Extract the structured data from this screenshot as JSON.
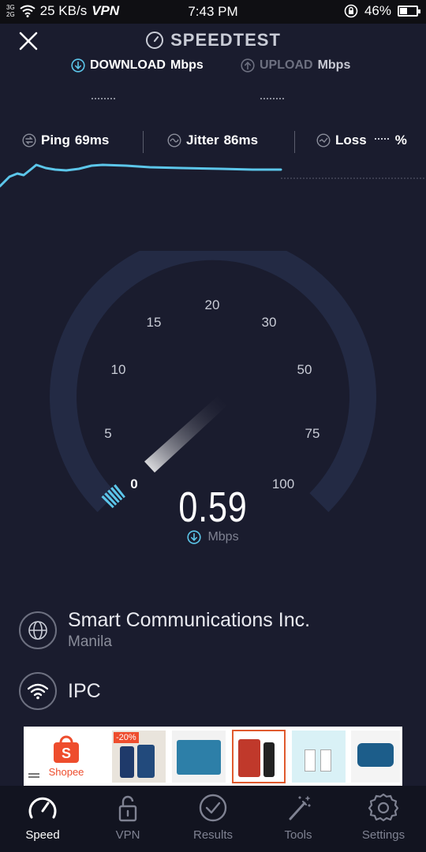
{
  "status_bar": {
    "net_top": "3G",
    "net_bottom": "2G",
    "speed": "25 KB/s",
    "vpn": "VPN",
    "time": "7:43 PM",
    "battery": "46%",
    "battery_level": 0.46
  },
  "header": {
    "title": "SPEEDTEST",
    "download_label": "DOWNLOAD",
    "upload_label": "UPLOAD",
    "unit": "Mbps"
  },
  "stats": {
    "ping_label": "Ping",
    "ping_value": "69ms",
    "jitter_label": "Jitter",
    "jitter_value": "86ms",
    "loss_label": "Loss",
    "loss_unit": "%"
  },
  "gauge": {
    "scale_labels": [
      "0",
      "5",
      "10",
      "15",
      "20",
      "30",
      "50",
      "75",
      "100"
    ],
    "value": "0.59",
    "unit": "Mbps"
  },
  "provider": {
    "name": "Smart Communications Inc.",
    "location": "Manila"
  },
  "network": {
    "name": "IPC"
  },
  "ad": {
    "brand": "Shopee",
    "discount": "-20%"
  },
  "tabs": [
    {
      "label": "Speed",
      "icon": "speedometer-icon",
      "active": true
    },
    {
      "label": "VPN",
      "icon": "lock-icon",
      "active": false
    },
    {
      "label": "Results",
      "icon": "check-circle-icon",
      "active": false
    },
    {
      "label": "Tools",
      "icon": "magic-wand-icon",
      "active": false
    },
    {
      "label": "Settings",
      "icon": "gear-icon",
      "active": false
    }
  ],
  "colors": {
    "background": "#1a1c2e",
    "accent": "#5cc6ea",
    "gauge_track": "#232a44"
  }
}
